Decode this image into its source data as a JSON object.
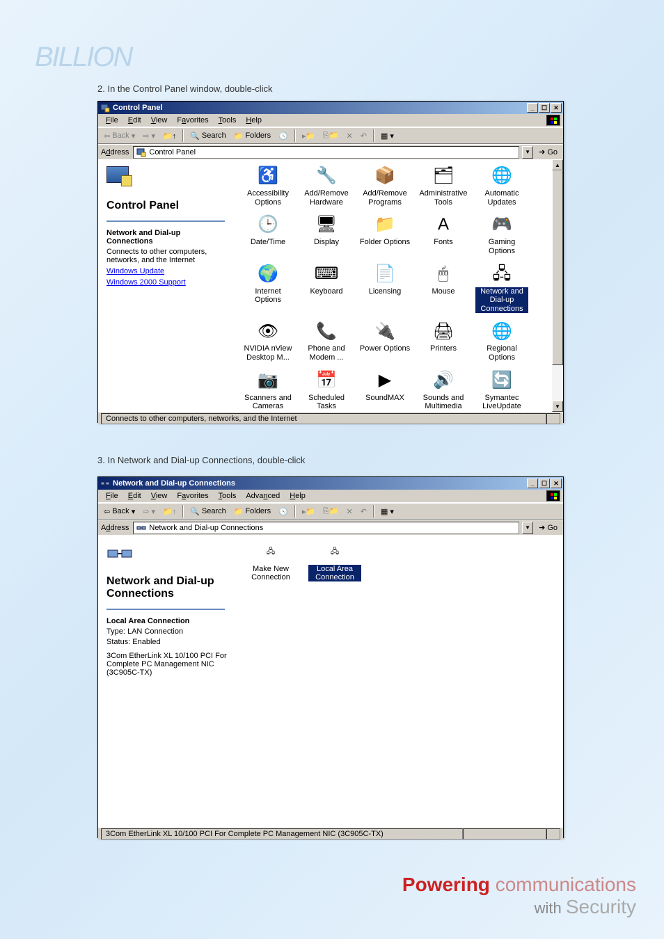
{
  "logo_top": "BILLION",
  "instruction2": "2. In the Control Panel window, double-click",
  "instruction3": "3. In Network and Dial-up Connections, double-click",
  "window1": {
    "title": "Control Panel",
    "menu": [
      "File",
      "Edit",
      "View",
      "Favorites",
      "Tools",
      "Help"
    ],
    "toolbar": {
      "back": "Back",
      "search": "Search",
      "folders": "Folders"
    },
    "address_label": "Address",
    "address_value": "Control Panel",
    "go_label": "Go",
    "leftpane": {
      "title": "Control Panel",
      "subhead": "Network and Dial-up Connections",
      "desc": "Connects to other computers, networks, and the Internet",
      "link1": "Windows Update",
      "link2": "Windows 2000 Support"
    },
    "icons": [
      {
        "label": "Accessibility Options",
        "glyph": "♿"
      },
      {
        "label": "Add/Remove Hardware",
        "glyph": "🔧"
      },
      {
        "label": "Add/Remove Programs",
        "glyph": "📦"
      },
      {
        "label": "Administrative Tools",
        "glyph": "🗂"
      },
      {
        "label": "Automatic Updates",
        "glyph": "🌐"
      },
      {
        "label": "Date/Time",
        "glyph": "🕒"
      },
      {
        "label": "Display",
        "glyph": "🖥"
      },
      {
        "label": "Folder Options",
        "glyph": "📁"
      },
      {
        "label": "Fonts",
        "glyph": "A"
      },
      {
        "label": "Gaming Options",
        "glyph": "🎮"
      },
      {
        "label": "Internet Options",
        "glyph": "🌍"
      },
      {
        "label": "Keyboard",
        "glyph": "⌨"
      },
      {
        "label": "Licensing",
        "glyph": "📄"
      },
      {
        "label": "Mouse",
        "glyph": "🖱"
      },
      {
        "label": "Network and Dial-up Connections",
        "glyph": "🖧",
        "selected": true
      },
      {
        "label": "NVIDIA nView Desktop M...",
        "glyph": "👁"
      },
      {
        "label": "Phone and Modem ...",
        "glyph": "📞"
      },
      {
        "label": "Power Options",
        "glyph": "🔌"
      },
      {
        "label": "Printers",
        "glyph": "🖨"
      },
      {
        "label": "Regional Options",
        "glyph": "🌐"
      },
      {
        "label": "Scanners and Cameras",
        "glyph": "📷"
      },
      {
        "label": "Scheduled Tasks",
        "glyph": "📅"
      },
      {
        "label": "SoundMAX",
        "glyph": "▶"
      },
      {
        "label": "Sounds and Multimedia",
        "glyph": "🔊"
      },
      {
        "label": "Symantec LiveUpdate",
        "glyph": "🔄"
      }
    ],
    "status": "Connects to other computers, networks, and the Internet"
  },
  "window2": {
    "title": "Network and Dial-up Connections",
    "menu": [
      "File",
      "Edit",
      "View",
      "Favorites",
      "Tools",
      "Advanced",
      "Help"
    ],
    "toolbar": {
      "back": "Back",
      "search": "Search",
      "folders": "Folders"
    },
    "address_label": "Address",
    "address_value": "Network and Dial-up Connections",
    "go_label": "Go",
    "leftpane": {
      "title": "Network and Dial-up Connections",
      "subhead": "Local Area Connection",
      "type": "Type: LAN Connection",
      "status": "Status: Enabled",
      "device": "3Com EtherLink XL 10/100 PCI For Complete PC Management NIC (3C905C-TX)"
    },
    "icons": [
      {
        "label": "Make New Connection",
        "glyph": "🖧"
      },
      {
        "label": "Local Area Connection",
        "glyph": "🖧",
        "selected": true
      }
    ],
    "status": "3Com EtherLink XL 10/100 PCI For Complete PC Management NIC (3C905C-TX)"
  },
  "footer": {
    "line1a": "Powering",
    "line1b": "communications",
    "line2a": "with",
    "line2b": "Security"
  }
}
